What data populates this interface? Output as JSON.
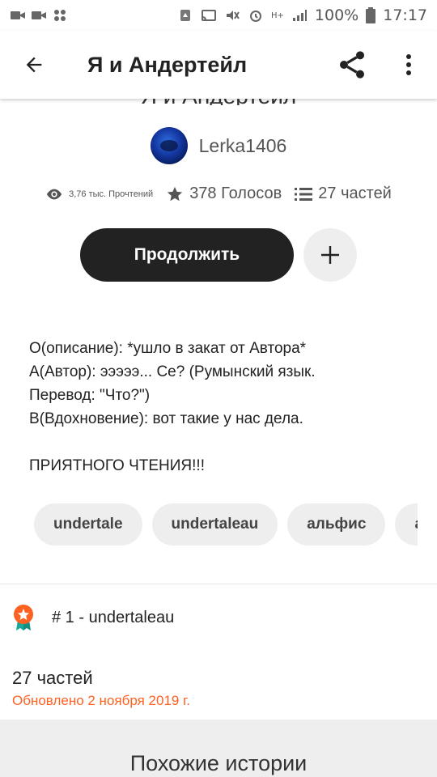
{
  "status_bar": {
    "battery": "100%",
    "time": "17:17",
    "network_label": "H+"
  },
  "app_bar": {
    "title": "Я и Андертейл"
  },
  "story": {
    "title": "Я и Андертейл",
    "author": "Lerka1406",
    "reads": "3,76 тыс. Прочтений",
    "votes": "378 Голосов",
    "parts": "27 частей"
  },
  "actions": {
    "continue_label": "Продолжить"
  },
  "description_lines": [
    "О(описание): *ушло в закат от Автора*",
    "А(Автор): эээээ... Се? (Румынский язык.",
    "Перевод: \"Что?\")",
    "В(Вдохновение): вот такие у нас дела.",
    "",
    "ПРИЯТНОГО ЧТЕНИЯ!!!"
  ],
  "tags": [
    "undertale",
    "undertaleau",
    "альфис",
    "a"
  ],
  "ranking": {
    "text": "# 1 - undertaleau"
  },
  "table_of_contents": {
    "parts_title": "27 частей",
    "updated": "Обновлено 2 ноября 2019 г."
  },
  "similar": {
    "heading": "Похожие истории"
  },
  "colors": {
    "accent": "#ff6122",
    "button_dark": "#222222",
    "chip_bg": "#eeeeee"
  }
}
